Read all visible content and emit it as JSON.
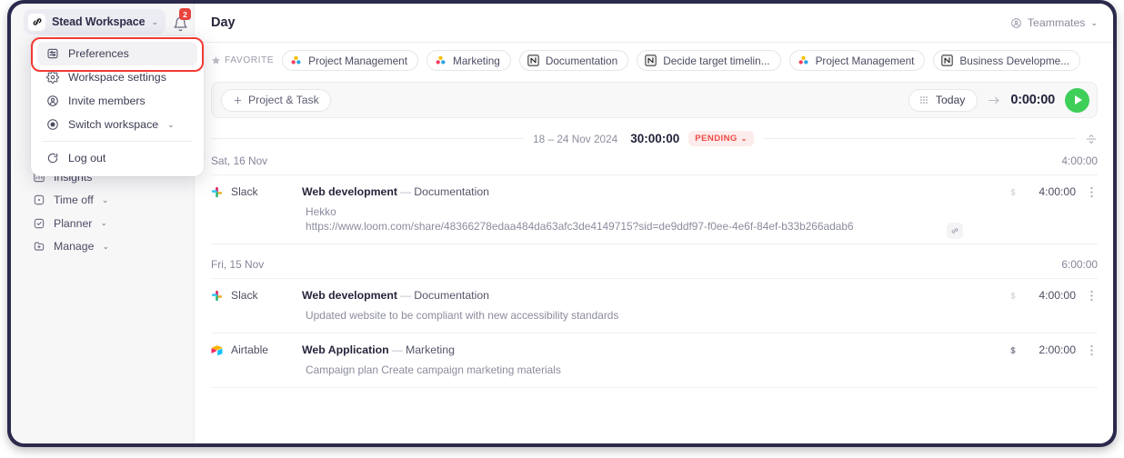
{
  "sidebar": {
    "workspace": {
      "name": "Stead Workspace",
      "logo_icon": "link-logo-icon",
      "chevron": "⌄"
    },
    "notifications": {
      "icon": "bell-icon",
      "badge": "2"
    },
    "menu": {
      "items": [
        {
          "label": "Preferences",
          "icon": "sliders-icon",
          "active": true
        },
        {
          "label": "Workspace settings",
          "icon": "gear-icon",
          "active": false
        },
        {
          "label": "Invite members",
          "icon": "user-add-icon",
          "active": false
        },
        {
          "label": "Switch workspace",
          "icon": "circle-dot-icon",
          "chevron": "⌄",
          "active": false
        },
        {
          "label": "Log out",
          "icon": "logout-icon",
          "active": false
        }
      ]
    },
    "nav": [
      {
        "label": "Insights",
        "icon": "insights-icon",
        "chevron": ""
      },
      {
        "label": "Time off",
        "icon": "time-off-icon",
        "chevron": "⌄"
      },
      {
        "label": "Planner",
        "icon": "planner-icon",
        "chevron": "⌄"
      },
      {
        "label": "Manage",
        "icon": "manage-icon",
        "chevron": "⌄"
      }
    ]
  },
  "topbar": {
    "title": "Day",
    "teammates_label": "Teammates",
    "teammates_icon": "user-circle-icon",
    "teammates_chevron": "⌄"
  },
  "favorites": {
    "label": "FAVORITE",
    "star_icon": "star-icon",
    "chips": [
      {
        "label": "Project Management",
        "icon": "asana-icon"
      },
      {
        "label": "Marketing",
        "icon": "asana-icon"
      },
      {
        "label": "Documentation",
        "icon": "notion-icon"
      },
      {
        "label": "Decide target timelin...",
        "icon": "notion-icon"
      },
      {
        "label": "Project Management",
        "icon": "asana-icon"
      },
      {
        "label": "Business Developme...",
        "icon": "notion-icon"
      }
    ]
  },
  "timer": {
    "add_button": "Project & Task",
    "add_icon": "plus-icon",
    "billable_icon": "dollar-icon",
    "today_label": "Today",
    "today_icon": "grid-dots-icon",
    "arrow_icon": "arrow-right-icon",
    "elapsed": "0:00:00",
    "play_icon": "play-icon",
    "play_color": "#3ecf58"
  },
  "week": {
    "range": "18 – 24 Nov 2024",
    "total": "30:00:00",
    "status": "PENDING",
    "status_chevron": "⌄",
    "status_color": "#ef4a44",
    "collapse_icon": "collapse-icon"
  },
  "days": [
    {
      "date_label": "Sat, 16 Nov",
      "day_total": "4:00:00",
      "entries": [
        {
          "app": "Slack",
          "app_icon": "slack-icon",
          "project": "Web development",
          "dash": "—",
          "task": "Documentation",
          "note_line1": "Hekko",
          "note_line2": "https://www.loom.com/share/48366278edaa484da63afc3de4149715?sid=de9ddf97-f0ee-4e6f-84ef-b33b266adab6",
          "billable": "$",
          "billable_on": false,
          "duration": "4:00:00",
          "more_icon": "more-vertical-icon",
          "link_icon": "link-icon"
        }
      ]
    },
    {
      "date_label": "Fri, 15 Nov",
      "day_total": "6:00:00",
      "entries": [
        {
          "app": "Slack",
          "app_icon": "slack-icon",
          "project": "Web development",
          "dash": "—",
          "task": "Documentation",
          "note_line1": "Updated website to be compliant with new accessibility standards",
          "note_line2": "",
          "billable": "$",
          "billable_on": false,
          "duration": "4:00:00",
          "more_icon": "more-vertical-icon",
          "link_icon": ""
        },
        {
          "app": "Airtable",
          "app_icon": "airtable-icon",
          "project": "Web Application",
          "dash": "—",
          "task": "Marketing",
          "note_line1": "Campaign plan Create campaign marketing materials",
          "note_line2": "",
          "billable": "$",
          "billable_on": true,
          "duration": "2:00:00",
          "more_icon": "more-vertical-icon",
          "link_icon": ""
        }
      ]
    }
  ]
}
